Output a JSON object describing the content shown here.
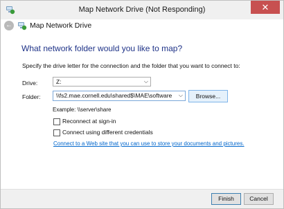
{
  "window": {
    "title": "Map Network Drive (Not Responding)",
    "close_glyph": "✕"
  },
  "nav": {
    "back_glyph": "←",
    "title": "Map Network Drive",
    "icon": "network-drive-icon"
  },
  "content": {
    "heading": "What network folder would you like to map?",
    "instructions": "Specify the drive letter for the connection and the folder that you want to connect to:",
    "drive": {
      "label": "Drive:",
      "value": "Z:"
    },
    "folder": {
      "label": "Folder:",
      "value": "\\\\fs2.mae.cornell.edu\\shared$\\MAE\\software"
    },
    "browse_label": "Browse...",
    "example": "Example: \\\\server\\share",
    "reconnect": {
      "label": "Reconnect at sign-in",
      "checked": false
    },
    "credentials": {
      "label": "Connect using different credentials",
      "checked": false
    },
    "link_text": "Connect to a Web site that you can use to store your documents and pictures."
  },
  "footer": {
    "finish_label": "Finish",
    "cancel_label": "Cancel"
  },
  "colors": {
    "heading": "#1e3287",
    "link": "#0066cc",
    "close_button": "#c75050"
  }
}
